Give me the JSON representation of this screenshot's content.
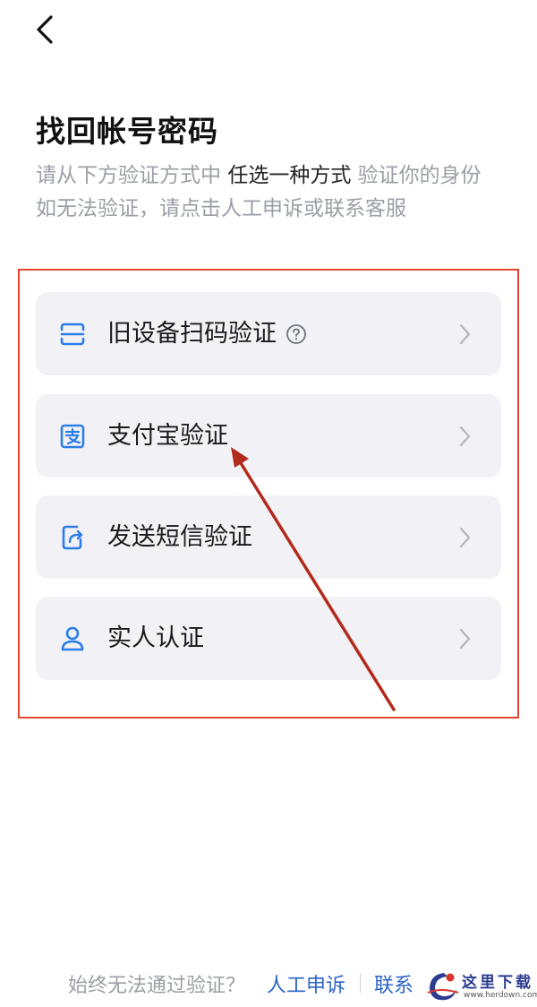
{
  "header": {
    "back_icon": "chevron-left-icon"
  },
  "title": "找回帐号密码",
  "subtitle": {
    "line1_a": "请从下方验证方式中 ",
    "line1_strong": "任选一种方式",
    "line1_b": " 验证你的身份",
    "line2": "如无法验证，请点击人工申诉或联系客服"
  },
  "options": [
    {
      "label": "旧设备扫码验证",
      "icon": "scan-icon",
      "has_help": true
    },
    {
      "label": "支付宝验证",
      "icon": "alipay-icon",
      "has_help": false
    },
    {
      "label": "发送短信验证",
      "icon": "sms-icon",
      "has_help": false
    },
    {
      "label": "实人认证",
      "icon": "person-icon",
      "has_help": false
    }
  ],
  "footer": {
    "question": "始终无法通过验证？",
    "appeal": "人工申诉",
    "contact": "联系"
  },
  "watermark": {
    "text": "这里下载",
    "url": "www.herdown.com"
  },
  "colors": {
    "accent_blue": "#2b7de9",
    "link_blue": "#2b64c6",
    "annotation_red": "#e5452f",
    "arrow_red": "#b22a1c",
    "card_bg": "#f2f2f6"
  }
}
